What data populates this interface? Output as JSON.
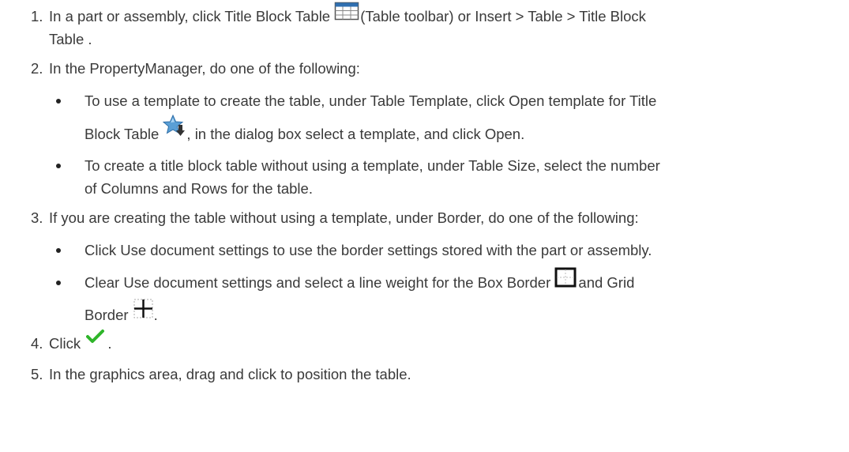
{
  "steps": [
    {
      "number": "1.",
      "lines": [
        {
          "before": "In a part or assembly, click Title Block Table ",
          "icon": "title-block-table-icon",
          "after": "(Table toolbar) or Insert > Table > Title Block"
        },
        {
          "text": "Table ."
        }
      ]
    },
    {
      "number": "2.",
      "text": "In the PropertyManager, do one of the following:",
      "bullets": [
        {
          "lines": [
            {
              "text": "To use a template to create the table, under Table Template, click Open template for Title"
            },
            {
              "before": "Block Table ",
              "icon": "open-template-icon",
              "after": ", in the dialog box select a template, and click Open."
            }
          ]
        },
        {
          "lines": [
            {
              "text": "To create a title block table without using a template, under Table Size, select the number"
            },
            {
              "text": "of Columns and Rows for the table."
            }
          ]
        }
      ]
    },
    {
      "number": "3.",
      "text": "If you are creating the table without using a template, under Border, do one of the following:",
      "bullets": [
        {
          "lines": [
            {
              "text": "Click Use document settings to use the border settings stored with the part or assembly."
            }
          ]
        },
        {
          "lines": [
            {
              "before": "Clear Use document settings and select a line weight for the Box Border ",
              "icon": "box-border-icon",
              "after": "and Grid"
            },
            {
              "before": "Border ",
              "icon": "grid-border-icon",
              "after": "."
            }
          ]
        }
      ]
    },
    {
      "number": "4.",
      "before": "Click ",
      "icon": "checkmark-icon",
      "after": " ."
    },
    {
      "number": "5.",
      "text": "In the graphics area, drag and click to position the table."
    }
  ],
  "colors": {
    "text": "#3a3a3a",
    "checkmark": "#2fb52a",
    "table_icon_header": "#2f6fb0",
    "star": "#5a9fd6"
  }
}
